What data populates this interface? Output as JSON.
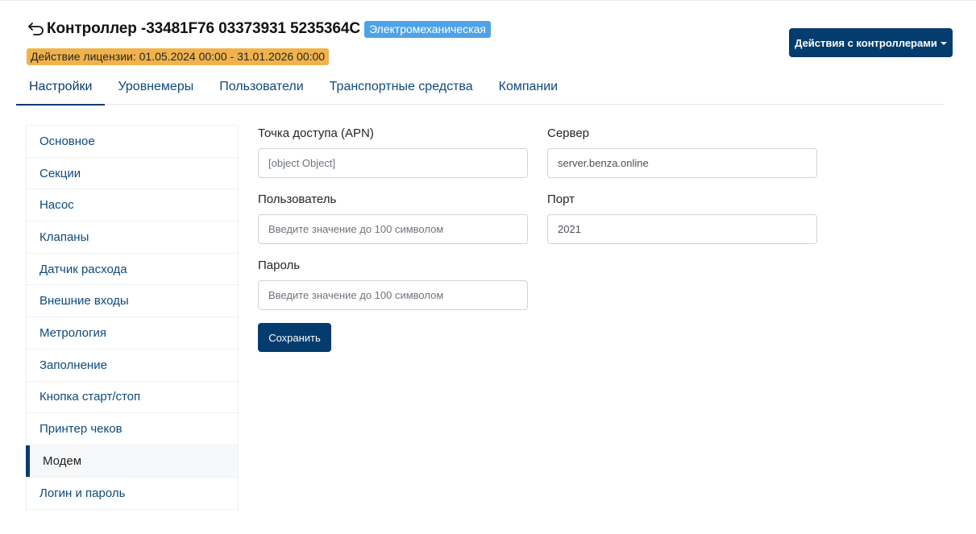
{
  "header": {
    "title": "Контроллер -33481F76 03373931 5235364C",
    "type_badge": "Электромеханическая",
    "license": "Действие лицензии: 01.05.2024 00:00 - 31.01.2026 00:00",
    "actions_label": "Действия с контроллерами",
    "back_icon": "back-arrow-icon"
  },
  "tabs": [
    {
      "label": "Настройки",
      "active": true
    },
    {
      "label": "Уровнемеры",
      "active": false
    },
    {
      "label": "Пользователи",
      "active": false
    },
    {
      "label": "Транспортные средства",
      "active": false
    },
    {
      "label": "Компании",
      "active": false
    }
  ],
  "sidebar": {
    "items": [
      {
        "label": "Основное"
      },
      {
        "label": "Секции"
      },
      {
        "label": "Насос"
      },
      {
        "label": "Клапаны"
      },
      {
        "label": "Датчик расхода"
      },
      {
        "label": "Внешние входы"
      },
      {
        "label": "Метрология"
      },
      {
        "label": "Заполнение"
      },
      {
        "label": "Кнопка старт/стоп"
      },
      {
        "label": "Принтер чеков"
      },
      {
        "label": "Модем",
        "active": true
      },
      {
        "label": "Логин и пароль"
      }
    ]
  },
  "form": {
    "apn": {
      "label": "Точка доступа (APN)",
      "value": "[object Object]"
    },
    "user": {
      "label": "Пользователь",
      "value": "",
      "placeholder": "Введите значение до 100 символом"
    },
    "password": {
      "label": "Пароль",
      "value": "",
      "placeholder": "Введите значение до 100 символом"
    },
    "server": {
      "label": "Сервер",
      "value": "server.benza.online"
    },
    "port": {
      "label": "Порт",
      "value": "2021"
    },
    "save_label": "Сохранить"
  },
  "colors": {
    "primary": "#053c6e",
    "badge": "#4ea3e8",
    "license": "#f0b34c",
    "link": "#0d4a7f"
  }
}
